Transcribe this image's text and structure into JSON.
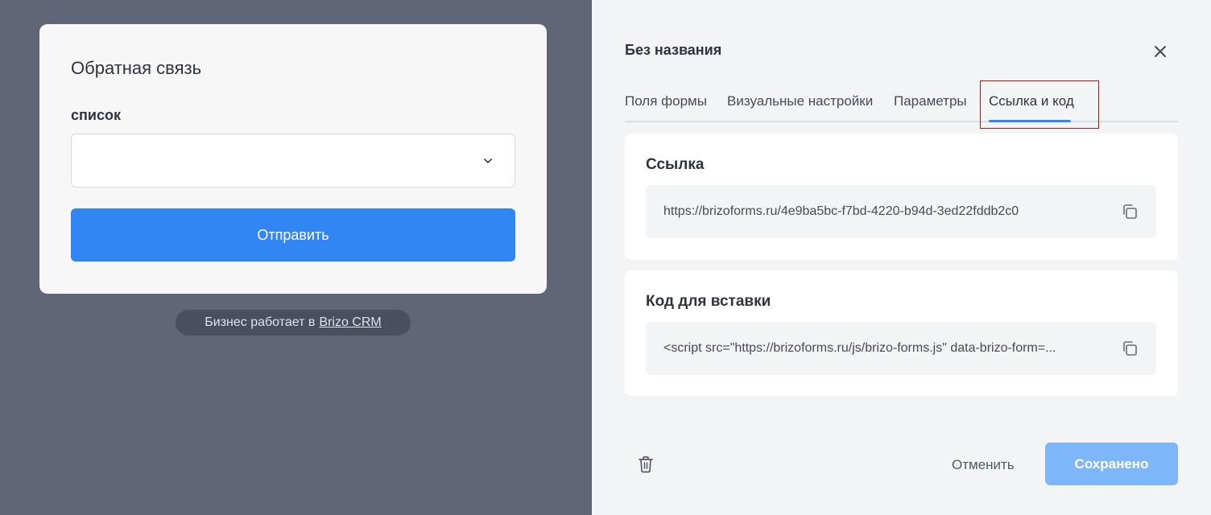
{
  "preview": {
    "form_title": "Обратная связь",
    "field_label": "список",
    "select_value": "",
    "submit_label": "Отправить",
    "powered_prefix": "Бизнес работает в",
    "powered_link": "Brizo CRM"
  },
  "panel": {
    "title": "Без названия",
    "tabs": [
      {
        "label": "Поля формы",
        "active": false
      },
      {
        "label": "Визуальные настройки",
        "active": false
      },
      {
        "label": "Параметры",
        "active": false
      },
      {
        "label": "Ссылка и код",
        "active": true
      }
    ],
    "link_section": {
      "title": "Ссылка",
      "value": "https://brizoforms.ru/4e9ba5bc-f7bd-4220-b94d-3ed22fddb2c0"
    },
    "embed_section": {
      "title": "Код для вставки",
      "value": "<script src=\"https://brizoforms.ru/js/brizo-forms.js\" data-brizo-form=..."
    },
    "cancel_label": "Отменить",
    "save_label": "Сохранено"
  },
  "colors": {
    "accent": "#3286f4",
    "save_disabled": "#7db7f9",
    "preview_bg": "#5e6677",
    "panel_bg": "#f3f4f6",
    "highlight_box": "#b01818"
  },
  "icons": [
    "chevron-down-icon",
    "close-icon",
    "copy-icon",
    "trash-icon"
  ]
}
